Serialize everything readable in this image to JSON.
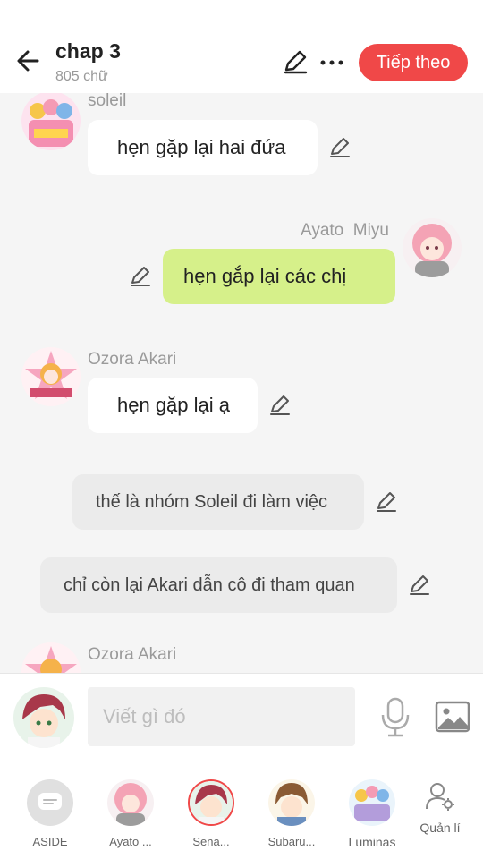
{
  "header": {
    "title": "chap 3",
    "word_count": "805 chữ",
    "next_label": "Tiếp theo"
  },
  "messages": {
    "m1": {
      "sender": "soleil",
      "text": "hẹn gặp lại hai đứa"
    },
    "m2": {
      "sender": "Ayato  Miyu",
      "text": "hẹn gắp lại các chị"
    },
    "m3": {
      "sender": "Ozora Akari",
      "text": "hẹn gặp lại ạ"
    },
    "n1": {
      "text": "thế là nhóm Soleil đi làm việc"
    },
    "n2": {
      "text": "chỉ còn lại Akari dẫn cô đi tham quan"
    },
    "m4": {
      "sender": "Ozora Akari"
    }
  },
  "composer": {
    "placeholder": "Viết gì đó"
  },
  "bottom_bar": {
    "aside": "ASIDE",
    "ayato": "Ayato ...",
    "sena": "Sena...",
    "subaru": "Subaru...",
    "luminas": "Luminas",
    "manage": "Quản lí"
  },
  "colors": {
    "accent": "#f04848",
    "sent_bubble": "#d6f08a",
    "background": "#f5f5f5"
  },
  "icons": [
    "back-arrow-icon",
    "pencil-icon",
    "more-dots-icon",
    "microphone-icon",
    "image-icon",
    "chat-icon",
    "person-gear-icon"
  ]
}
